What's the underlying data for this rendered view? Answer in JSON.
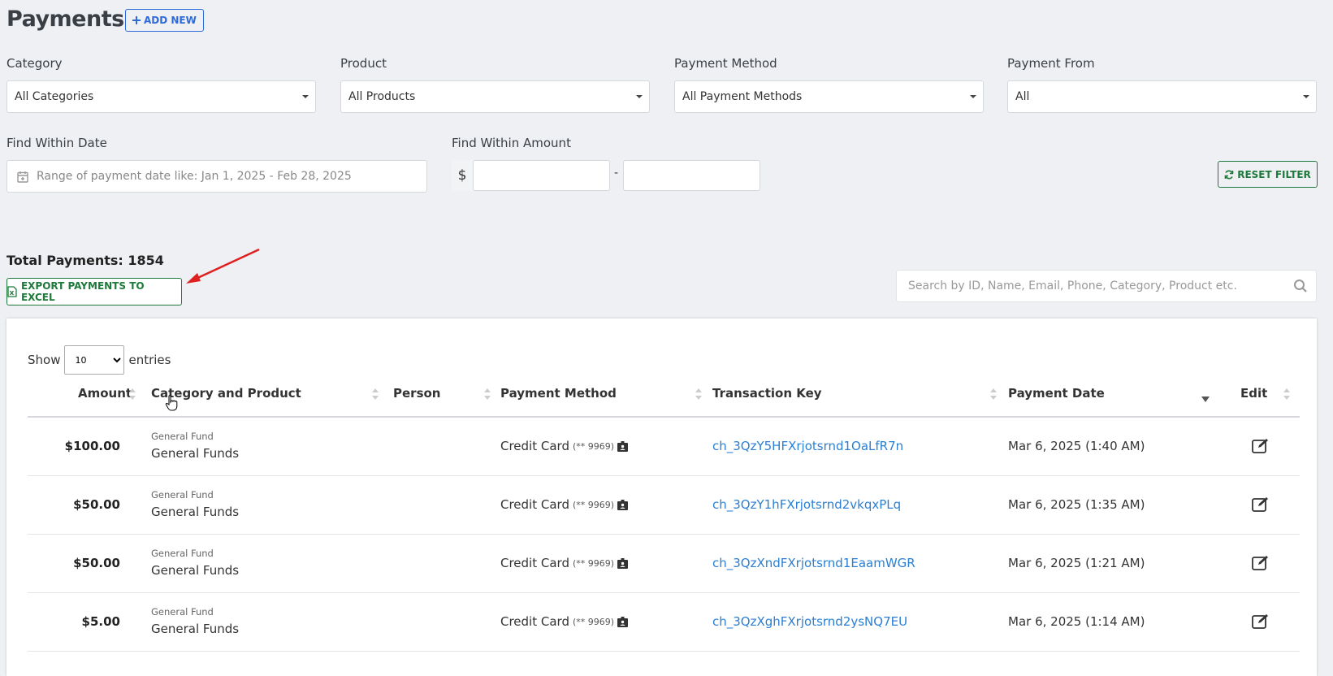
{
  "header": {
    "title": "Payments",
    "add_new": "ADD NEW"
  },
  "filters": {
    "category": {
      "label": "Category",
      "value": "All Categories"
    },
    "product": {
      "label": "Product",
      "value": "All Products"
    },
    "payment_method": {
      "label": "Payment Method",
      "value": "All Payment Methods"
    },
    "payment_from": {
      "label": "Payment From",
      "value": "All"
    },
    "date": {
      "label": "Find Within Date",
      "placeholder": "Range of payment date like: Jan 1, 2025 - Feb 28, 2025"
    },
    "amount": {
      "label": "Find Within Amount",
      "currency": "$",
      "separator": "-"
    },
    "reset": "RESET FILTER"
  },
  "summary": {
    "total": "Total Payments: 1854",
    "export": "EXPORT PAYMENTS TO EXCEL"
  },
  "search": {
    "placeholder": "Search by ID, Name, Email, Phone, Category, Product etc."
  },
  "table": {
    "show_label": "Show",
    "entries_label": "entries",
    "page_size": "10",
    "columns": [
      "Amount",
      "Category and Product",
      "Person",
      "Payment Method",
      "Transaction Key",
      "Payment Date",
      "Edit"
    ],
    "rows": [
      {
        "amount": "$100.00",
        "category": "General Fund",
        "product": "General Funds",
        "method": "Credit Card",
        "mask": "(** 9969)",
        "key": "ch_3QzY5HFXrjotsrnd1OaLfR7n",
        "date": "Mar 6, 2025 (1:40 AM)"
      },
      {
        "amount": "$50.00",
        "category": "General Fund",
        "product": "General Funds",
        "method": "Credit Card",
        "mask": "(** 9969)",
        "key": "ch_3QzY1hFXrjotsrnd2vkqxPLq",
        "date": "Mar 6, 2025 (1:35 AM)"
      },
      {
        "amount": "$50.00",
        "category": "General Fund",
        "product": "General Funds",
        "method": "Credit Card",
        "mask": "(** 9969)",
        "key": "ch_3QzXndFXrjotsrnd1EaamWGR",
        "date": "Mar 6, 2025 (1:21 AM)"
      },
      {
        "amount": "$5.00",
        "category": "General Fund",
        "product": "General Funds",
        "method": "Credit Card",
        "mask": "(** 9969)",
        "key": "ch_3QzXghFXrjotsrnd2ysNQ7EU",
        "date": "Mar 6, 2025 (1:14 AM)"
      }
    ]
  },
  "colors": {
    "blue": "#2f6bd8",
    "green": "#1e7a3b",
    "link": "#2a7fd4",
    "annotation_arrow": "#e02020"
  }
}
